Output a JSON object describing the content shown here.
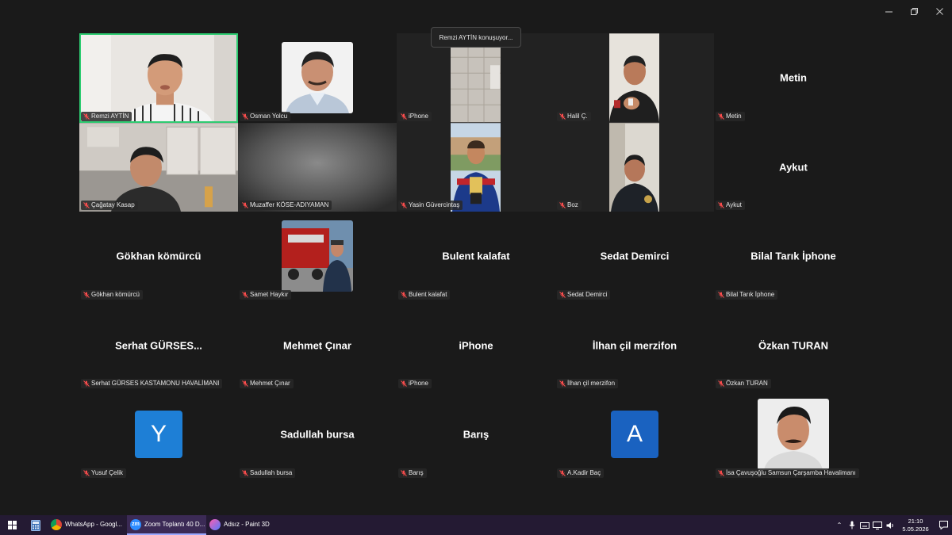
{
  "speaking_banner": "Remzi AYTİN konuşuyor...",
  "colors": {
    "active_border": "#2ecc71",
    "avatar_blue_1": "#1e7fd6",
    "avatar_blue_2": "#1a62c0",
    "taskbar": "#241a33"
  },
  "participants": [
    {
      "display": "",
      "label": "Remzi AYTİN",
      "kind": "video-man"
    },
    {
      "display": "",
      "label": "Osman Yolcu",
      "kind": "photo-man"
    },
    {
      "display": "",
      "label": "iPhone",
      "kind": "video-door"
    },
    {
      "display": "",
      "label": "Halil Ç.",
      "kind": "video-man2"
    },
    {
      "display": "Metin",
      "label": "Metin",
      "kind": "name"
    },
    {
      "display": "",
      "label": "Çağatay Kasap",
      "kind": "video-kitchen"
    },
    {
      "display": "",
      "label": "Muzaffer KÖSE-ADIYAMAN",
      "kind": "video-blur"
    },
    {
      "display": "",
      "label": "Yasin Güvercintaş",
      "kind": "video-athlete"
    },
    {
      "display": "",
      "label": "Boz",
      "kind": "video-man3"
    },
    {
      "display": "Aykut",
      "label": "Aykut",
      "kind": "name"
    },
    {
      "display": "Gökhan  kömürcü",
      "label": "Gökhan  kömürcü",
      "kind": "name"
    },
    {
      "display": "",
      "label": "Samet Haykır",
      "kind": "photo-firetruck"
    },
    {
      "display": "Bulent kalafat",
      "label": "Bulent kalafat",
      "kind": "name"
    },
    {
      "display": "Sedat Demirci",
      "label": "Sedat Demirci",
      "kind": "name"
    },
    {
      "display": "Bilal Tarık İphone",
      "label": "Bilal Tarık İphone",
      "kind": "name"
    },
    {
      "display": "Serhat  GÜRSES...",
      "label": "Serhat GÜRSES KASTAMONU HAVALİMANI",
      "kind": "name"
    },
    {
      "display": "Mehmet Çınar",
      "label": "Mehmet Çınar",
      "kind": "name"
    },
    {
      "display": "iPhone",
      "label": "iPhone",
      "kind": "name"
    },
    {
      "display": "İlhan çil merzifon",
      "label": "İlhan çil merzifon",
      "kind": "name"
    },
    {
      "display": "Özkan TURAN",
      "label": "Özkan TURAN",
      "kind": "name"
    },
    {
      "display": "Y",
      "label": "Yusuf Çelik",
      "kind": "letter",
      "color": "#1e7fd6"
    },
    {
      "display": "Sadullah bursa",
      "label": "Sadullah bursa",
      "kind": "name"
    },
    {
      "display": "Barış",
      "label": "Barış",
      "kind": "name"
    },
    {
      "display": "A",
      "label": "A.Kadir Baç",
      "kind": "letter",
      "color": "#1a62c0"
    },
    {
      "display": "",
      "label": "İsa Çavuşoğlu Samsun Çarşamba Havalimanı",
      "kind": "photo-man2"
    }
  ],
  "taskbar": {
    "apps": [
      {
        "label": "WhatsApp - Googl...",
        "icon": "chrome-icon",
        "active": false
      },
      {
        "label": "Zoom Toplantı 40 D...",
        "icon": "zoom-icon",
        "active": true
      },
      {
        "label": "Adsız - Paint 3D",
        "icon": "paint3d-icon",
        "active": false
      }
    ],
    "time": "21:10",
    "date": "5.05.2026"
  }
}
